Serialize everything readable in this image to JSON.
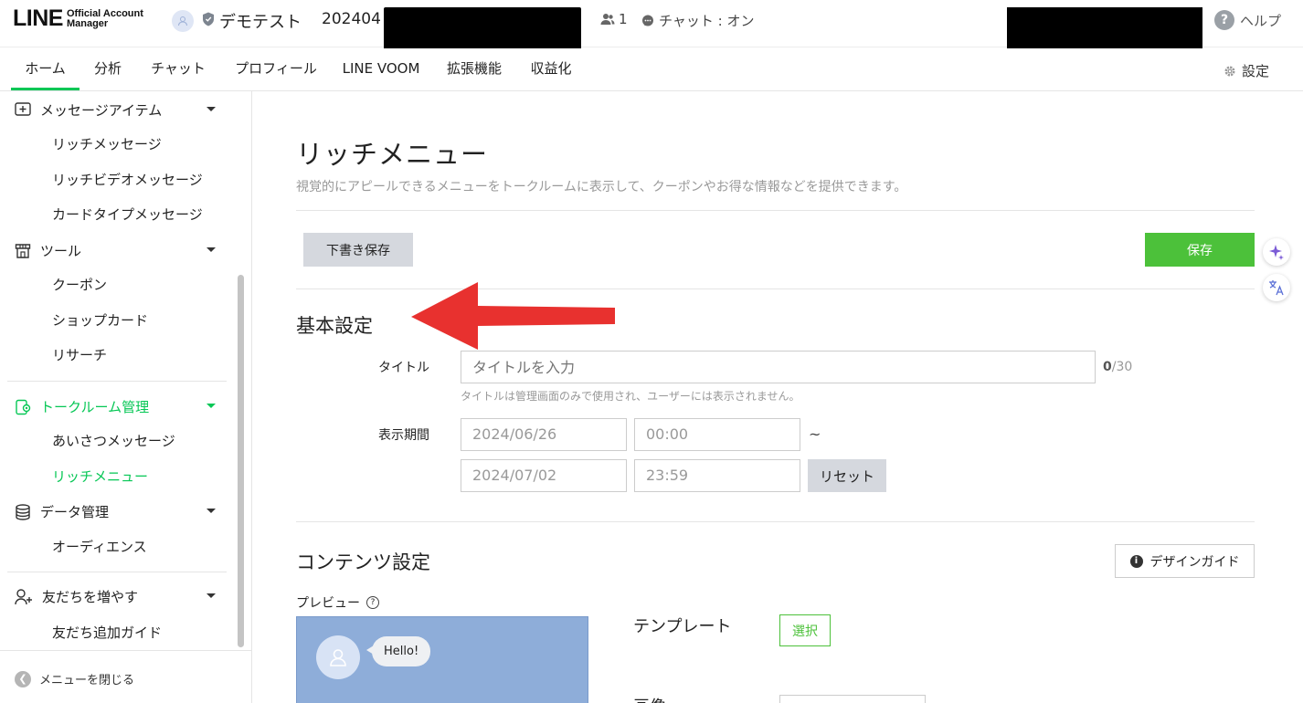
{
  "header": {
    "logo_main": "LINE",
    "logo_sub_line1": "Official Account",
    "logo_sub_line2": "Manager",
    "account_name": "デモテスト",
    "account_id": "202404",
    "friends_count": "1",
    "chat_status": "チャット : オン",
    "help_label": "ヘルプ"
  },
  "nav": {
    "tabs": [
      {
        "label": "ホーム"
      },
      {
        "label": "分析"
      },
      {
        "label": "チャット"
      },
      {
        "label": "プロフィール"
      },
      {
        "label": "LINE VOOM"
      },
      {
        "label": "拡張機能"
      },
      {
        "label": "収益化"
      }
    ],
    "settings_label": "設定"
  },
  "sidebar": {
    "message_items": {
      "label": "メッセージアイテム",
      "items": [
        "リッチメッセージ",
        "リッチビデオメッセージ",
        "カードタイプメッセージ"
      ]
    },
    "tools": {
      "label": "ツール",
      "items": [
        "クーポン",
        "ショップカード",
        "リサーチ"
      ]
    },
    "talkroom": {
      "label": "トークルーム管理",
      "items": [
        "あいさつメッセージ",
        "リッチメニュー"
      ]
    },
    "data_mgmt": {
      "label": "データ管理",
      "items": [
        "オーディエンス"
      ]
    },
    "grow": {
      "label": "友だちを増やす",
      "items": [
        "友だち追加ガイド"
      ]
    },
    "close_label": "メニューを閉じる"
  },
  "main": {
    "title": "リッチメニュー",
    "description": "視覚的にアピールできるメニューをトークルームに表示して、クーポンやお得な情報などを提供できます。",
    "draft_button": "下書き保存",
    "save_button": "保存",
    "basic": {
      "heading": "基本設定",
      "title_label": "タイトル",
      "title_placeholder": "タイトルを入力",
      "title_count": "0",
      "title_max": "/30",
      "title_hint": "タイトルは管理画面のみで使用され、ユーザーには表示されません。",
      "period_label": "表示期間",
      "start_date": "2024/06/26",
      "start_time": "00:00",
      "range_sep": "~",
      "end_date": "2024/07/02",
      "end_time": "23:59",
      "reset_button": "リセット"
    },
    "content": {
      "heading": "コンテンツ設定",
      "guide_button": "デザインガイド",
      "preview_label": "プレビュー",
      "preview_bubble": "Hello!",
      "template_label": "テンプレート",
      "select_button": "選択",
      "image_label": "画像"
    }
  },
  "colors": {
    "brand_green": "#06c755",
    "save_green": "#4cc13a",
    "arrow_red": "#e8312f",
    "preview_bg": "#8eadd9"
  }
}
